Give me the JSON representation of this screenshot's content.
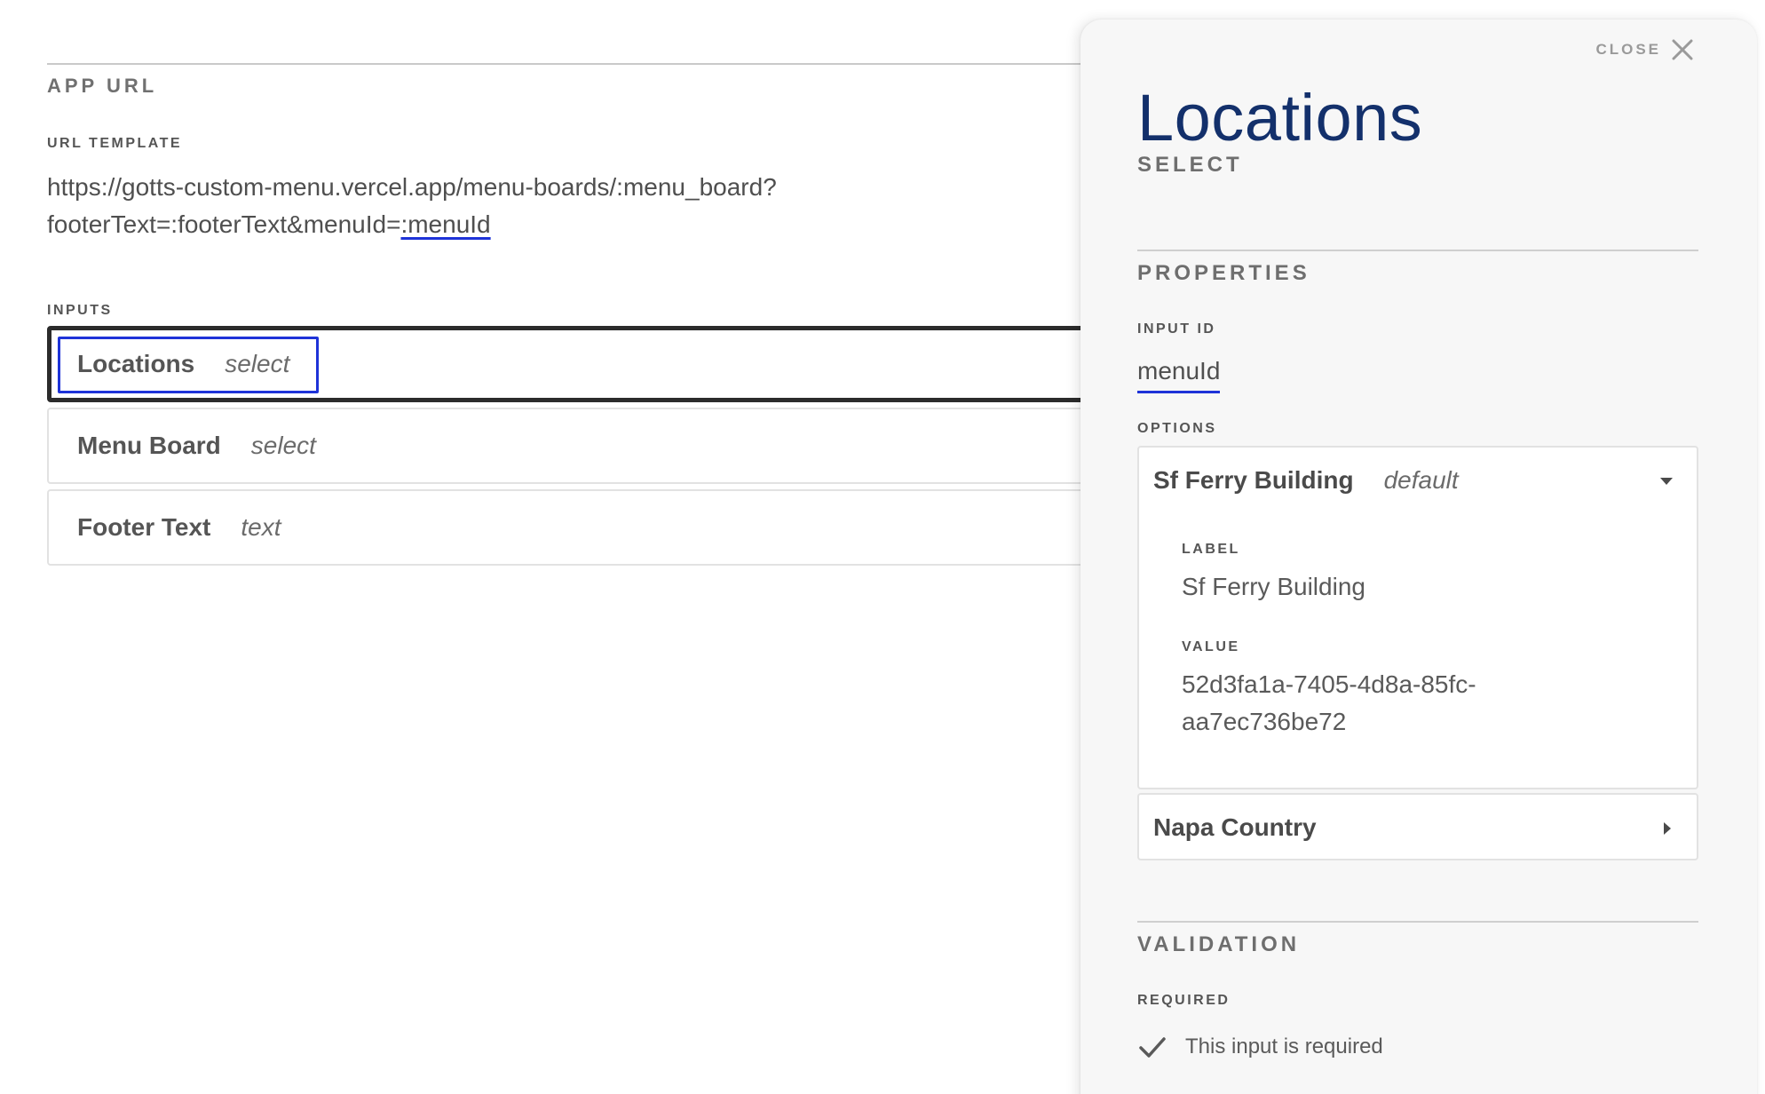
{
  "app_url": {
    "section_title": "APP URL",
    "url_template_label": "URL TEMPLATE",
    "url_line1": "https://gotts-custom-menu.vercel.app/menu-boards/:menu_board?",
    "url_line2_prefix": "footerText=:footerText&menuId=",
    "url_line2_token": ":menuId"
  },
  "inputs": {
    "label": "INPUTS",
    "items": [
      {
        "name": "Locations",
        "type": "select"
      },
      {
        "name": "Menu Board",
        "type": "select"
      },
      {
        "name": "Footer Text",
        "type": "text"
      }
    ]
  },
  "panel": {
    "close_label": "CLOSE",
    "title": "Locations",
    "subtitle": "SELECT",
    "properties_title": "PROPERTIES",
    "input_id_label": "INPUT ID",
    "input_id_value": "menuId",
    "options_label": "OPTIONS",
    "options": [
      {
        "name": "Sf Ferry Building",
        "tag": "default",
        "expanded": true,
        "label_title": "LABEL",
        "label_value": "Sf Ferry Building",
        "value_title": "VALUE",
        "value_line1": "52d3fa1a-7405-4d8a-85fc-",
        "value_line2": "aa7ec736be72"
      },
      {
        "name": "Napa Country",
        "expanded": false
      }
    ],
    "validation_title": "VALIDATION",
    "required_label": "REQUIRED",
    "required_text": "This input is required"
  },
  "colors": {
    "accent": "#1e33d8",
    "title": "#13306b",
    "panel_bg": "#f7f7f7"
  },
  "icons": [
    "close-icon",
    "caret-down-icon",
    "caret-right-icon",
    "checkmark-icon"
  ]
}
